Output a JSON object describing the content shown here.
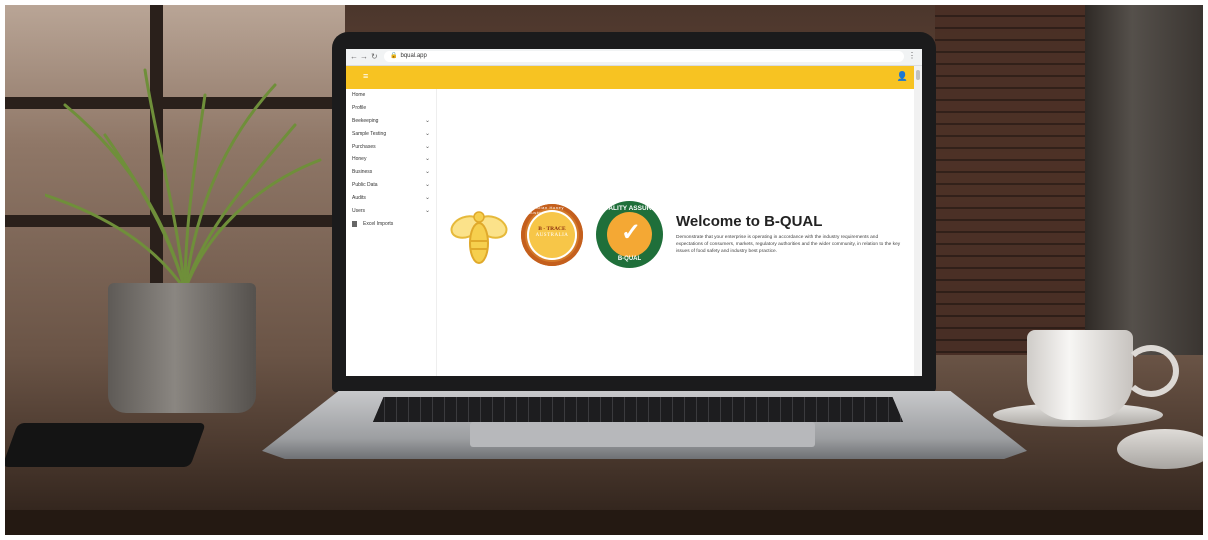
{
  "browser": {
    "url": "bqual.app",
    "back_icon": "arrow-left",
    "forward_icon": "arrow-right",
    "reload_icon": "reload",
    "lock_icon": "lock"
  },
  "appbar": {
    "color": "#f7c322",
    "menu_icon": "hamburger",
    "user_icon": "user"
  },
  "sidebar": {
    "items": [
      {
        "label": "Home",
        "expandable": false
      },
      {
        "label": "Profile",
        "expandable": false
      },
      {
        "label": "Beekeeping",
        "expandable": true
      },
      {
        "label": "Sample Testing",
        "expandable": true
      },
      {
        "label": "Purchases",
        "expandable": true
      },
      {
        "label": "Honey",
        "expandable": true
      },
      {
        "label": "Business",
        "expandable": true
      },
      {
        "label": "Public Data",
        "expandable": true
      },
      {
        "label": "Audits",
        "expandable": true
      },
      {
        "label": "Users",
        "expandable": true
      },
      {
        "label": "Excel Imports",
        "expandable": false,
        "icon": "file"
      }
    ]
  },
  "logos": {
    "btrace": {
      "ring": "Australian Honey Industry",
      "line1": "B - TRACE",
      "line2": "AUSTRALIA"
    },
    "quality": {
      "top": "QUALITY ASSURED",
      "bottom": "B-QUAL"
    }
  },
  "main": {
    "title": "Welcome to B-QUAL",
    "description": "Demonstrate that your enterprise is operating in accordance with the industry requirements and expectations of consumers, markets, regulatory authorities and the wider community, in relation to the key issues of food safety and industry best practice."
  }
}
